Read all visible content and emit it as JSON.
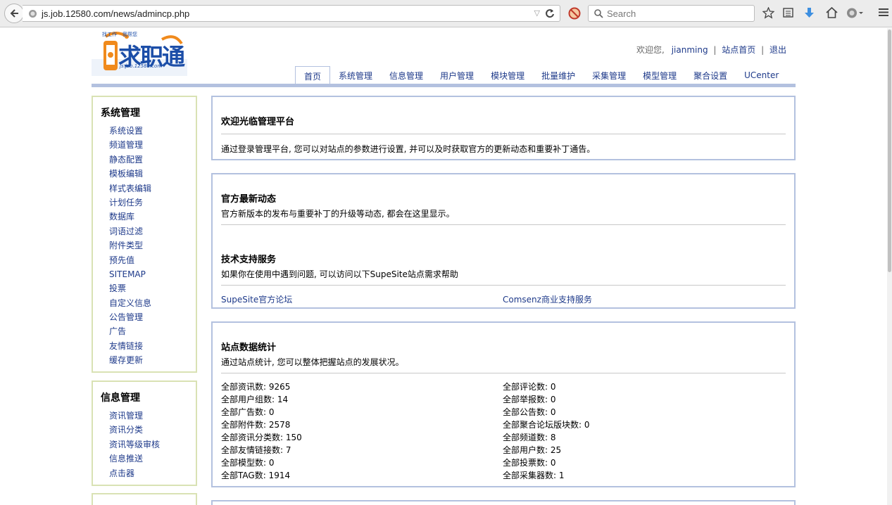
{
  "browser": {
    "url": "js.job.12580.com/news/admincp.php",
    "search_placeholder": "Search"
  },
  "site": {
    "logo_main": "求职通",
    "logo_tag1": "找工作",
    "logo_tag2": "我帮您",
    "logo_domain": "js.job.12580.com"
  },
  "topinfo": {
    "welcome": "欢迎您,",
    "username": "jianming",
    "home_link": "站点首页",
    "logout_link": "退出"
  },
  "mainnav": [
    {
      "label": "首页"
    },
    {
      "label": "系统管理"
    },
    {
      "label": "信息管理"
    },
    {
      "label": "用户管理"
    },
    {
      "label": "模块管理"
    },
    {
      "label": "批量维护"
    },
    {
      "label": "采集管理"
    },
    {
      "label": "模型管理"
    },
    {
      "label": "聚合设置"
    },
    {
      "label": "UCenter"
    }
  ],
  "sidebar": {
    "system": {
      "title": "系统管理",
      "items": [
        "系统设置",
        "频道管理",
        "静态配置",
        "模板编辑",
        "样式表编辑",
        "计划任务",
        "数据库",
        "词语过滤",
        "附件类型",
        "预先值",
        "SITEMAP",
        "投票",
        "自定义信息",
        "公告管理",
        "广告",
        "友情链接",
        "缓存更新"
      ]
    },
    "info": {
      "title": "信息管理",
      "items": [
        "资讯管理",
        "资讯分类",
        "资讯等级审核",
        "信息推送",
        "点击器"
      ]
    }
  },
  "welcome_panel": {
    "title": "欢迎光临管理平台",
    "desc": "通过登录管理平台, 您可以对站点的参数进行设置, 并可以及时获取官方的更新动态和重要补丁通告。"
  },
  "news_panel": {
    "title": "官方最新动态",
    "desc": "官方新版本的发布与重要补丁的升级等动态, 都会在这里显示。",
    "support_title": "技术支持服务",
    "support_desc": "如果你在使用中遇到问题, 可以访问以下SupeSite站点需求帮助",
    "link1": "SupeSite官方论坛",
    "link2": "Comsenz商业支持服务"
  },
  "stats_panel": {
    "title": "站点数据统计",
    "desc": "通过站点统计, 您可以整体把握站点的发展状况。",
    "rows": [
      [
        "全部资讯数: 9265",
        "全部评论数: 0"
      ],
      [
        "全部用户组数: 14",
        "全部举报数: 0"
      ],
      [
        "全部广告数: 0",
        "全部公告数: 0"
      ],
      [
        "全部附件数: 2578",
        "全部聚合论坛版块数: 0"
      ],
      [
        "全部资讯分类数: 150",
        "全部频道数: 8"
      ],
      [
        "全部友情链接数: 7",
        "全部用户数: 25"
      ],
      [
        "全部模型数: 0",
        "全部投票数: 0"
      ],
      [
        "全部TAG数: 1914",
        "全部采集器数: 1"
      ]
    ]
  }
}
